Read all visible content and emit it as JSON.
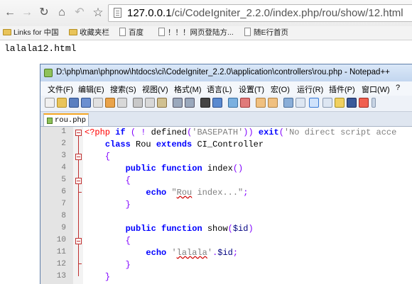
{
  "browser": {
    "url_host": "127.0.0.1",
    "url_path": "/ci/CodeIgniter_2.2.0/index.php/rou/show/12.html",
    "bookmarks": [
      {
        "label": "Links for 中国",
        "type": "folder"
      },
      {
        "label": "收藏夹栏",
        "type": "folder"
      },
      {
        "label": "百度",
        "type": "page"
      },
      {
        "label": "！！！网页登陆方...",
        "type": "page"
      },
      {
        "label": "随E行首页",
        "type": "page"
      }
    ]
  },
  "page": {
    "body_text": "lalala12.html"
  },
  "editor": {
    "title": "D:\\php\\man\\phpnow\\htdocs\\ci\\CodeIgniter_2.2.0\\application\\controllers\\rou.php - Notepad++",
    "menu": [
      "文件(F)",
      "编辑(E)",
      "搜索(S)",
      "视图(V)",
      "格式(M)",
      "语言(L)",
      "设置(T)",
      "宏(O)",
      "运行(R)",
      "插件(P)",
      "窗口(W)",
      "?"
    ],
    "tab_label": "rou.php",
    "line_numbers": [
      "1",
      "2",
      "3",
      "4",
      "5",
      "6",
      "7",
      "8",
      "9",
      "10",
      "11",
      "12",
      "13"
    ]
  }
}
